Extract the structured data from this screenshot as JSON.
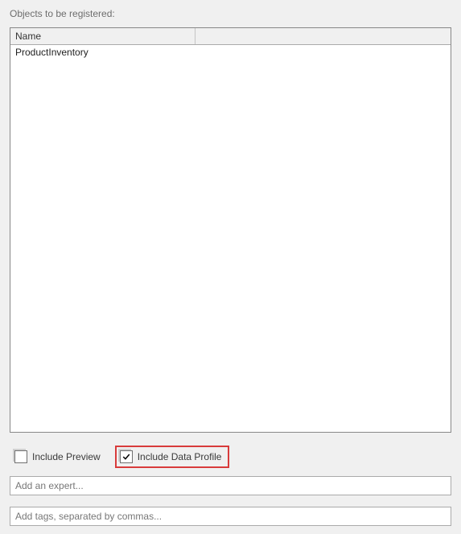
{
  "section_label": "Objects to be registered:",
  "table": {
    "columns": {
      "name": "Name"
    },
    "rows": [
      {
        "name": "ProductInventory"
      }
    ]
  },
  "checkboxes": {
    "include_preview": {
      "label": "Include Preview",
      "checked": false
    },
    "include_data_profile": {
      "label": "Include Data Profile",
      "checked": true
    }
  },
  "inputs": {
    "expert_placeholder": "Add an expert...",
    "tags_placeholder": "Add tags, separated by commas..."
  }
}
